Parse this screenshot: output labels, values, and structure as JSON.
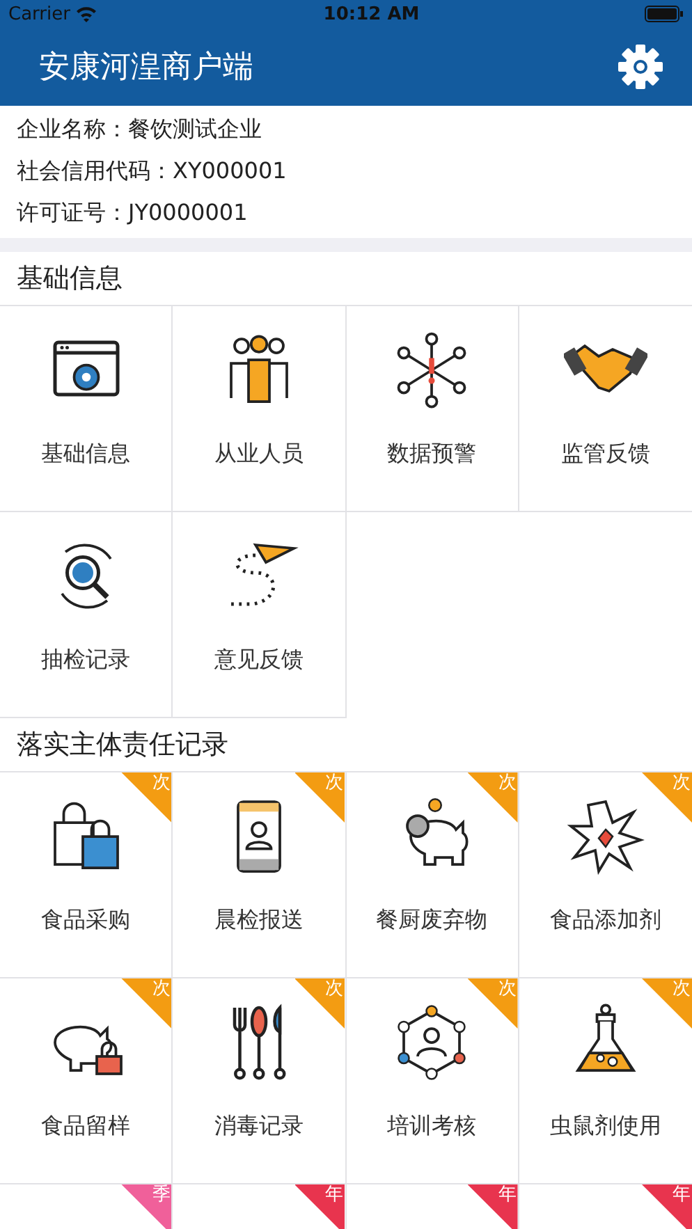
{
  "status_bar": {
    "carrier": "Carrier",
    "time": "10:12 AM"
  },
  "nav": {
    "title": "安康河湟商户端"
  },
  "company": [
    {
      "label": "企业名称：",
      "value": "餐饮测试企业"
    },
    {
      "label": "社会信用代码：",
      "value": "XY000001"
    },
    {
      "label": "许可证号：",
      "value": "JY0000001"
    }
  ],
  "sections": [
    {
      "title": "基础信息",
      "items": [
        {
          "label": "基础信息"
        },
        {
          "label": "从业人员"
        },
        {
          "label": "数据预警"
        },
        {
          "label": "监管反馈"
        },
        {
          "label": "抽检记录"
        },
        {
          "label": "意见反馈"
        }
      ]
    },
    {
      "title": "落实主体责任记录",
      "items": [
        {
          "label": "食品采购",
          "badge": "次",
          "color": "#f39c12"
        },
        {
          "label": "晨检报送",
          "badge": "次",
          "color": "#f39c12"
        },
        {
          "label": "餐厨废弃物",
          "badge": "次",
          "color": "#f39c12"
        },
        {
          "label": "食品添加剂",
          "badge": "次",
          "color": "#f39c12"
        },
        {
          "label": "食品留样",
          "badge": "次",
          "color": "#f39c12"
        },
        {
          "label": "消毒记录",
          "badge": "次",
          "color": "#f39c12"
        },
        {
          "label": "培训考核",
          "badge": "次",
          "color": "#f39c12"
        },
        {
          "label": "虫鼠剂使用",
          "badge": "次",
          "color": "#f39c12"
        },
        {
          "badge": "季",
          "color": "#f0609a"
        },
        {
          "badge": "年",
          "color": "#e8344e"
        },
        {
          "badge": "年",
          "color": "#e8344e"
        },
        {
          "badge": "年",
          "color": "#e8344e"
        }
      ]
    }
  ]
}
